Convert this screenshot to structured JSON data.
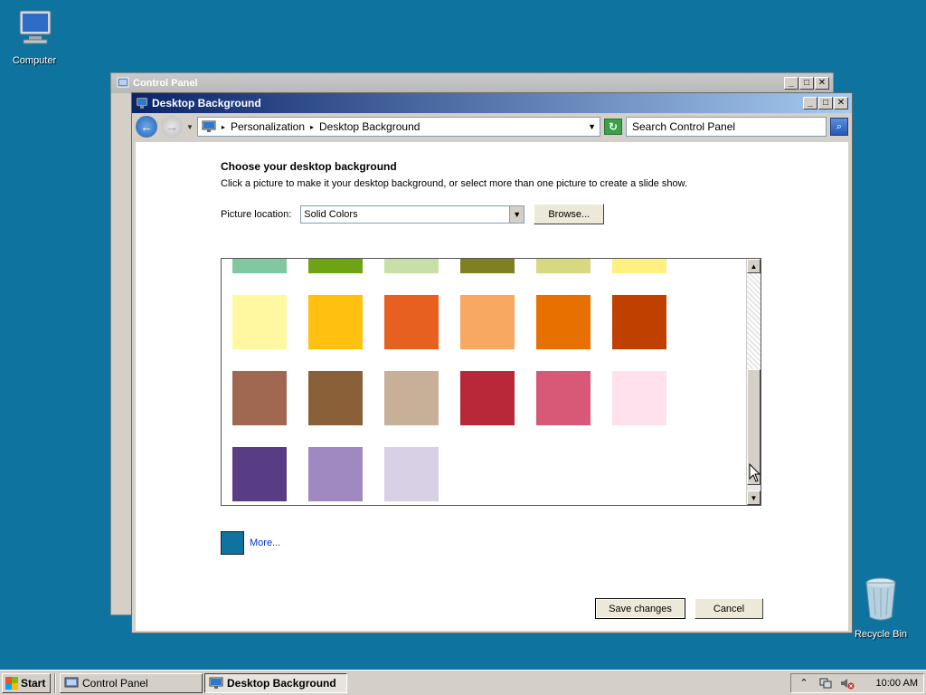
{
  "desktop": {
    "computer_label": "Computer",
    "recycle_label": "Recycle Bin",
    "background_color": "#0f73a0"
  },
  "back_window": {
    "title": "Control Panel"
  },
  "front_window": {
    "title": "Desktop Background",
    "breadcrumb": [
      "Personalization",
      "Desktop Background"
    ],
    "search_placeholder": "Search Control Panel"
  },
  "main": {
    "heading": "Choose your desktop background",
    "subtext": "Click a picture to make it your desktop background, or select more than one picture to create a slide show.",
    "location_label": "Picture location:",
    "location_value": "Solid Colors",
    "browse_label": "Browse...",
    "more_label": "More...",
    "save_label": "Save changes",
    "cancel_label": "Cancel"
  },
  "swatches": {
    "row0": [
      "#7fc8a0",
      "#6ea414",
      "#c6e0a8",
      "#808020",
      "#d8d880",
      "#fff080"
    ],
    "row1": [
      "#fff8a0",
      "#ffc010",
      "#e86020",
      "#f8a860",
      "#e87000",
      "#c04000"
    ],
    "row2": [
      "#a06850",
      "#8a6038",
      "#c8b098",
      "#b82838",
      "#d85878",
      "#ffe0ec"
    ],
    "row3": [
      "#583c84",
      "#a088c0",
      "#d8d0e4"
    ]
  },
  "taskbar": {
    "start_label": "Start",
    "task1": "Control Panel",
    "task2": "Desktop Background",
    "clock": "10:00 AM"
  }
}
